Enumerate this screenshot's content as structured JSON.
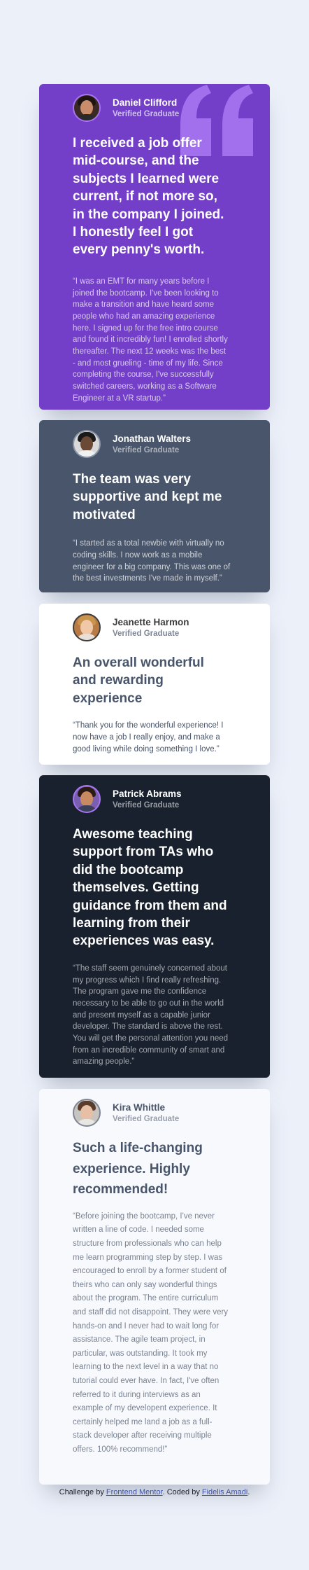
{
  "colors": {
    "page_bg": "#ecf0f9",
    "moderate_violet": "#733fc8",
    "grayish_blue": "#48556a",
    "white": "#ffffff",
    "dark_blackish_blue": "#19212e",
    "light_gray": "#f8f9fc",
    "avatar_border": "#a775f1"
  },
  "testimonials": [
    {
      "name": "Daniel Clifford",
      "role": "Verified Graduate",
      "avatar_icon": "avatar-daniel",
      "headline": "I received a job offer mid-course, and the subjects I learned were current, if not more so, in the company I joined. I honestly feel I got every penny's worth.",
      "quote": "“I was an EMT for many years before I joined the bootcamp. I've been looking to make a transition and have heard some people who had an amazing experience here. I signed up for the free intro course and found it incredibly fun! I enrolled shortly thereafter. The next 12 weeks was the best - and most grueling - time of my life. Since completing the course, I've successfully switched careers, working as a Software Engineer at a VR startup.”"
    },
    {
      "name": "Jonathan Walters",
      "role": "Verified Graduate",
      "avatar_icon": "avatar-jonathan",
      "headline": "The team was very supportive and kept me motivated",
      "quote": "“I started as a total newbie with virtually no coding skills. I now work as a mobile engineer for a big company. This was one of the best investments I've made in myself.”"
    },
    {
      "name": "Jeanette Harmon",
      "role": "Verified Graduate",
      "avatar_icon": "avatar-jeanette",
      "headline": "An overall wonderful and rewarding experience",
      "quote": "“Thank you for the wonderful experience! I now have a job I really enjoy, and make a good living while doing something I love.”"
    },
    {
      "name": "Patrick Abrams",
      "role": "Verified Graduate",
      "avatar_icon": "avatar-patrick",
      "headline": "Awesome teaching support from TAs who did the bootcamp themselves. Getting guidance from them and learning from their experiences was easy.",
      "quote": "“The staff seem genuinely concerned about my progress which I find really refreshing. The program gave me the confidence necessary to be able to go out in the world and present myself as a capable junior developer. The standard is above the rest. You will get the personal attention you need from an incredible community of smart and amazing people.”"
    },
    {
      "name": "Kira Whittle",
      "role": "Verified Graduate",
      "avatar_icon": "avatar-kira",
      "headline": "Such a life-changing experience. Highly recommended!",
      "quote": "“Before joining the bootcamp, I've never written a line of code. I needed some structure from professionals who can help me learn programming step by step. I was encouraged to enroll by a former student of theirs who can only say wonderful things about the program. The entire curriculum and staff did not disappoint. They were very hands-on and I never had to wait long for assistance. The agile team project, in particular, was outstanding. It took my learning to the next level in a way that no tutorial could ever have. In fact, I've often referred to it during interviews as an example of my developent experience. It certainly helped me land a job as a full-stack developer after receiving multiple offers. 100% recommend!”"
    }
  ],
  "attribution": {
    "prefix": "Challenge by ",
    "challenge_link": "Frontend Mentor",
    "middle": ". Coded by ",
    "author_link": "Fidelis Amadi",
    "suffix": "."
  }
}
